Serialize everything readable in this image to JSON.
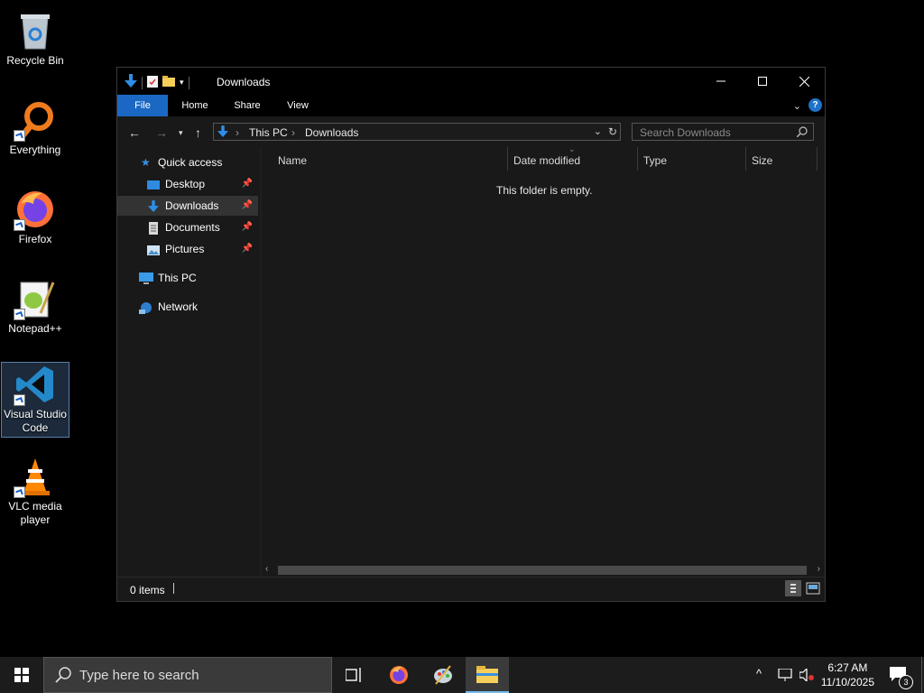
{
  "desktop": {
    "icons": [
      {
        "label": "Recycle Bin",
        "icon": "recycle-bin-icon"
      },
      {
        "label": "Everything",
        "icon": "everything-search-icon"
      },
      {
        "label": "Firefox",
        "icon": "firefox-icon"
      },
      {
        "label": "Notepad++",
        "icon": "notepad-plus-plus-icon"
      },
      {
        "label": "Visual Studio Code",
        "icon": "vscode-icon"
      },
      {
        "label": "VLC media player",
        "icon": "vlc-icon"
      }
    ]
  },
  "window": {
    "title": "Downloads",
    "ribbon_tabs": [
      "File",
      "Home",
      "Share",
      "View"
    ],
    "address": {
      "crumbs": [
        "This PC",
        "Downloads"
      ]
    },
    "search_placeholder": "Search Downloads",
    "nav": {
      "quick_access": "Quick access",
      "items": [
        "Desktop",
        "Downloads",
        "Documents",
        "Pictures"
      ],
      "this_pc": "This PC",
      "network": "Network"
    },
    "columns": [
      "Name",
      "Date modified",
      "Type",
      "Size"
    ],
    "empty_message": "This folder is empty.",
    "status_items": "0 items"
  },
  "taskbar": {
    "search_placeholder": "Type here to search",
    "time": "6:27 AM",
    "date": "11/10/2025",
    "notification_count": "3"
  },
  "colors": {
    "accent": "#1a68c4",
    "taskbar": "#1c1c1c",
    "window_bg": "#191919"
  }
}
